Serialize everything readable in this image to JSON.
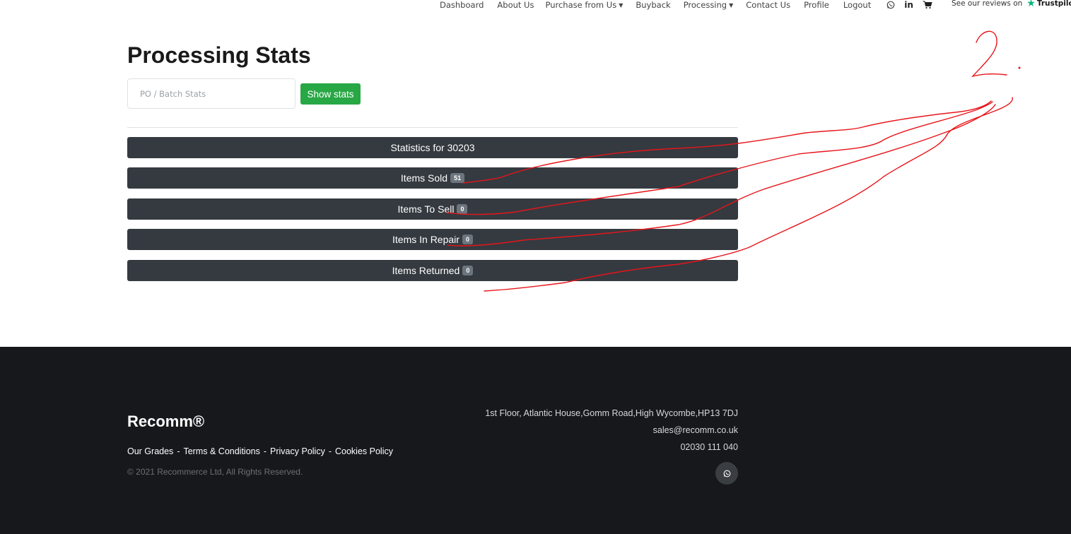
{
  "nav": {
    "items": [
      {
        "label": "Dashboard",
        "has_dropdown": false
      },
      {
        "label": "About Us",
        "has_dropdown": false
      },
      {
        "label": "Purchase from Us",
        "has_dropdown": true
      },
      {
        "label": "Buyback",
        "has_dropdown": false
      },
      {
        "label": "Processing",
        "has_dropdown": true
      },
      {
        "label": "Contact Us",
        "has_dropdown": false
      },
      {
        "label": "Profile",
        "has_dropdown": false
      },
      {
        "label": "Logout",
        "has_dropdown": false
      }
    ],
    "icons": [
      "whatsapp-icon",
      "linkedin-icon",
      "cart-icon"
    ],
    "trustpilot": {
      "prefix": "See our reviews on",
      "brand": "Trustpilot",
      "star_color": "#00b67a"
    }
  },
  "main": {
    "title": "Processing Stats",
    "search": {
      "placeholder": "PO / Batch Stats",
      "value": ""
    },
    "show_button": "Show stats",
    "stats_header": "Statistics for 30203",
    "stats": [
      {
        "label": "Items Sold",
        "count": "51"
      },
      {
        "label": "Items To Sell",
        "count": "0"
      },
      {
        "label": "Items In Repair",
        "count": "0"
      },
      {
        "label": "Items Returned",
        "count": "0"
      }
    ]
  },
  "annotation": {
    "text": "2.",
    "color": "#e8141a"
  },
  "footer": {
    "brand": "Recomm®",
    "links": [
      "Our Grades",
      "Terms & Conditions",
      "Privacy Policy",
      "Cookies Policy"
    ],
    "copyright": "© 2021 Recommerce Ltd, All Rights Reserved.",
    "address": "1st Floor, Atlantic House,Gomm Road,High Wycombe,HP13 7DJ",
    "email": "sales@recomm.co.uk",
    "phone": "02030 111 040"
  },
  "colors": {
    "accent_green": "#28a745",
    "bar_dark": "#343a40",
    "badge": "#6c757d",
    "footer_bg": "#16181b"
  }
}
